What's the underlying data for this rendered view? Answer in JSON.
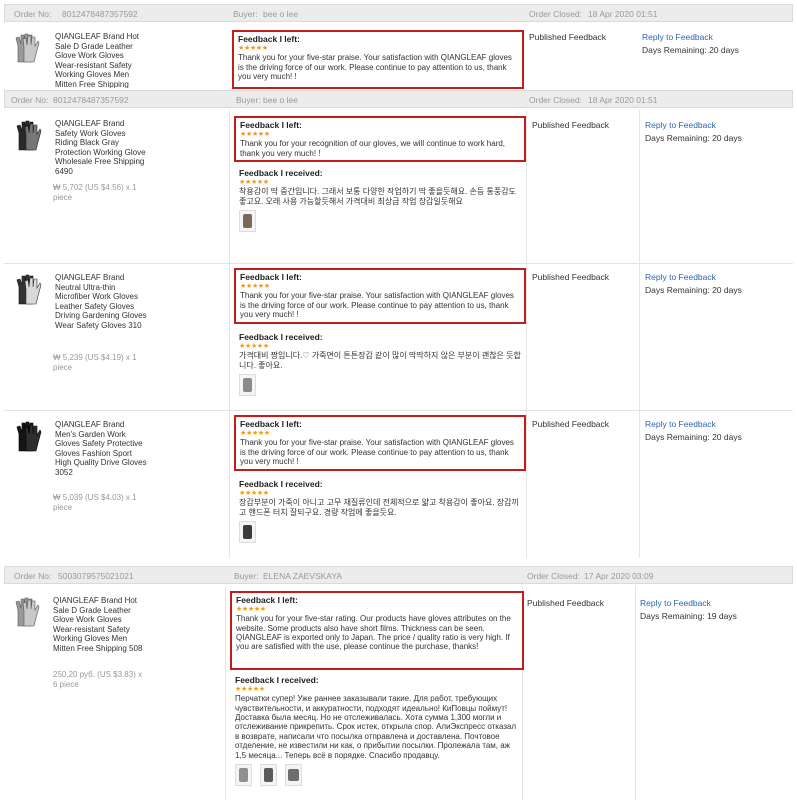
{
  "labels": {
    "order_no": "Order No:",
    "buyer": "Buyer:",
    "order_closed": "Order Closed:",
    "feedback_left": "Feedback I left:",
    "feedback_received": "Feedback I received:",
    "status": "Published Feedback",
    "reply": "Reply to Feedback",
    "stars": "★★★★★"
  },
  "orders": [
    {
      "order_no": "8012478487357592",
      "buyer": "bee o lee",
      "closed": "18 Apr 2020 01:51",
      "items": [
        {
          "name": "QIANGLEAF Brand Hot Sale D Grade Leather Glove Work Gloves Wear-resistant Safety Working Gloves Men Mitten Free Shipping",
          "price": "",
          "left_text": "Thank you for your five-star praise. Your satisfaction with QIANGLEAF gloves is the driving force of our work. Please continue to pay attention to us, thank you very much! !",
          "received_text": "",
          "days": "Days Remaining: 20 days"
        }
      ]
    },
    {
      "order_no": "8012478487357592",
      "buyer": "bee o lee",
      "closed": "18 Apr 2020 01:51",
      "items": [
        {
          "name": "QIANGLEAF Brand Safety Work Gloves Riding Black Gray Protection Working Glove Wholesale Free Shipping 6490",
          "price": "₩ 5,702 (US $4.56) x 1 piece",
          "left_text": "Thank you for your recognition of our gloves, we will continue to work hard, thank you very much! !",
          "received_text": "착용감이 딱 중간입니다. 그래서 보통 다양한 작업하기 딱 좋을듯해요. 손등 통풍감도 좋고요. 오래 사용 가능할듯해서 가격대비 최상급 작업 장갑일듯해요",
          "days": "Days Remaining: 20 days"
        },
        {
          "name": "QIANGLEAF Brand Neutral Ultra-thin Microfiber Work Gloves Leather Safety Gloves Driving Gardening Gloves Wear Safety Gloves 310",
          "price": "₩ 5,239 (US $4.19) x 1 piece",
          "left_text": "Thank you for your five-star praise. Your satisfaction with QIANGLEAF gloves is the driving force of our work. Please continue to pay attention to us, thank you very much! !",
          "received_text": "가격대비 짱입니다.♡ 가죽면이 튼튼장갑 같이 많이 딱딱하지 않은 부분이 괜찮은 듯합니다. 좋아요.",
          "days": "Days Remaining: 20 days"
        },
        {
          "name": "QIANGLEAF Brand Men's Garden Work Gloves Safety Protective Gloves Fashion Sport High Quality Drive Gloves 3052",
          "price": "₩ 5,039 (US $4.03) x 1 piece",
          "left_text": "Thank you for your five-star praise. Your satisfaction with QIANGLEAF gloves is the driving force of our work. Please continue to pay attention to us, thank you very much! !",
          "received_text": "장갑부분이 가죽이 아니고 고무 재질류인데 전체적으로 얇고 착용감이 좋아요. 장갑끼고 핸드폰 터치 잘되구요. 경량 작업에 좋을듯요.",
          "days": "Days Remaining: 20 days"
        }
      ]
    },
    {
      "order_no": "5003079575021021",
      "buyer": "ELENA ZAEVSKAYA",
      "closed": "17 Apr 2020 03:09",
      "items": [
        {
          "name": "QIANGLEAF Brand Hot Sale D Grade Leather Glove Work Gloves Wear-resistant Safety Working Gloves Men Mitten Free Shipping 508",
          "price": "250,20 руб. (US $3.83) x 6 piece",
          "left_text": "Thank you for your five-star rating. Our products have gloves attributes on the website. Some products also have short films. Thickness can be seen. QIANGLEAF is exported only to Japan. The price / quality ratio is very high. If you are satisfied with the use, please continue the purchase, thanks!",
          "received_text": "Перчатки супер! Уже раннее заказывали такие. Для работ, требующих чувствительности, и аккуратности, подходят идеально! КиПовцы поймут! Доставка была месяц. Но не отслеживалась. Хота сумма 1,300 могли и отслеживание прикрепить. Срок истек, открыла спор. АлиЭкспресс отказал в возврате, написали что посылка отправлена и доставлена. Почтовое отделение, не известили ни как, о прибытии посылки. Пролежала там, аж 1,5 месяца... Теперь всё в порядке. Спасибо продавцу.",
          "days": "Days Remaining: 19 days"
        }
      ]
    }
  ]
}
